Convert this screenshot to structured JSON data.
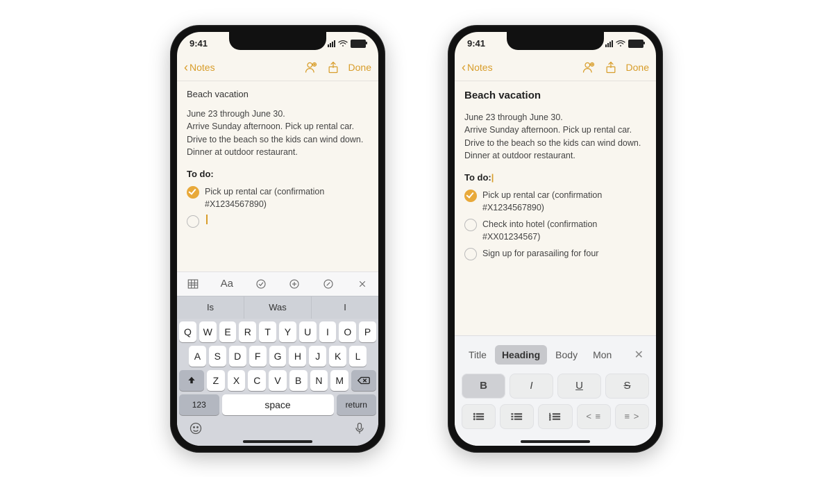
{
  "status": {
    "time": "9:41"
  },
  "nav": {
    "back": "Notes",
    "done": "Done"
  },
  "note": {
    "title": "Beach vacation",
    "paragraph": "June 23 through June 30.\nArrive Sunday afternoon. Pick up rental car. Drive to the beach so the kids can wind down. Dinner at outdoor restaurant.",
    "todo_heading": "To do:"
  },
  "left": {
    "todos": [
      {
        "text": "Pick up rental car (confirmation #X1234567890)",
        "checked": true
      }
    ],
    "suggestions": [
      "Is",
      "Was",
      "I"
    ],
    "format_label": "Aa",
    "keys_row1": [
      "Q",
      "W",
      "E",
      "R",
      "T",
      "Y",
      "U",
      "I",
      "O",
      "P"
    ],
    "keys_row2": [
      "A",
      "S",
      "D",
      "F",
      "G",
      "H",
      "J",
      "K",
      "L"
    ],
    "keys_row3": [
      "Z",
      "X",
      "C",
      "V",
      "B",
      "N",
      "M"
    ],
    "fn_123": "123",
    "fn_space": "space",
    "fn_return": "return"
  },
  "right": {
    "todos": [
      {
        "text": "Pick up rental car (confirmation #X1234567890)",
        "checked": true
      },
      {
        "text": "Check into hotel (confirmation #XX01234567)",
        "checked": false
      },
      {
        "text": "Sign up for parasailing for four",
        "checked": false
      }
    ],
    "styles": [
      "Title",
      "Heading",
      "Body",
      "Mon"
    ],
    "selected_style": "Heading",
    "biu": {
      "b": "B",
      "i": "I",
      "u": "U",
      "s": "S"
    },
    "indent": {
      "out": "<",
      "in": ">"
    }
  }
}
